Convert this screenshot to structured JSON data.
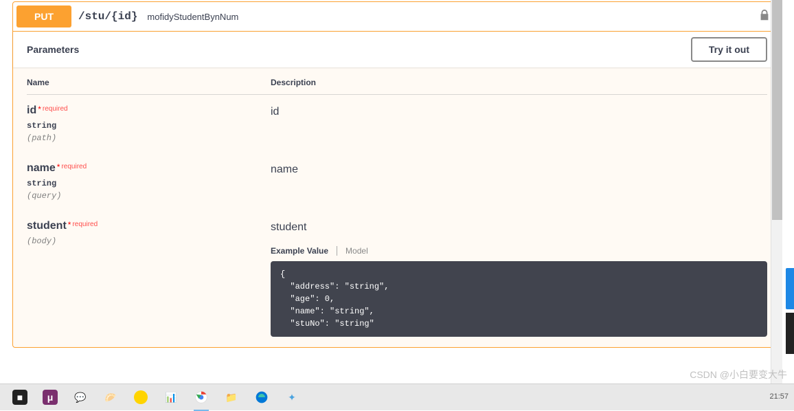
{
  "opblock": {
    "method": "PUT",
    "path": "/stu/{id}",
    "summary": "mofidyStudentBynNum"
  },
  "sections": {
    "parameters_title": "Parameters",
    "try_it_out": "Try it out"
  },
  "columns": {
    "name": "Name",
    "description": "Description"
  },
  "params": [
    {
      "name": "id",
      "required_star": "*",
      "required": "required",
      "type": "string",
      "in": "(path)",
      "desc": "id"
    },
    {
      "name": "name",
      "required_star": "*",
      "required": "required",
      "type": "string",
      "in": "(query)",
      "desc": "name"
    },
    {
      "name": "student",
      "required_star": "*",
      "required": "required",
      "type": "",
      "in": "(body)",
      "desc": "student"
    }
  ],
  "model_tabs": {
    "example": "Example Value",
    "model": "Model"
  },
  "example_body": "{\n  \"address\": \"string\",\n  \"age\": 0,\n  \"name\": \"string\",\n  \"stuNo\": \"string\"",
  "watermark": "CSDN @小白要变大牛",
  "clock": {
    "time": "21:57"
  },
  "taskbar_icons": [
    {
      "name": "start",
      "color": "#222",
      "glyph": "⊞"
    },
    {
      "name": "app1",
      "color": "#7a2f6e",
      "glyph": "μ"
    },
    {
      "name": "wechat",
      "color": "#fff",
      "glyph": "💬"
    },
    {
      "name": "app3",
      "color": "#f0c040",
      "glyph": "🥠"
    },
    {
      "name": "app4",
      "color": "#ffd400",
      "glyph": "●"
    },
    {
      "name": "app5",
      "color": "#4aa3df",
      "glyph": "📊"
    },
    {
      "name": "chrome",
      "color": "#fff",
      "glyph": "◉"
    },
    {
      "name": "explorer",
      "color": "#ffc94a",
      "glyph": "📁"
    },
    {
      "name": "edge",
      "color": "#0078d7",
      "glyph": "◎"
    },
    {
      "name": "app9",
      "color": "#fff",
      "glyph": "⚙"
    }
  ]
}
